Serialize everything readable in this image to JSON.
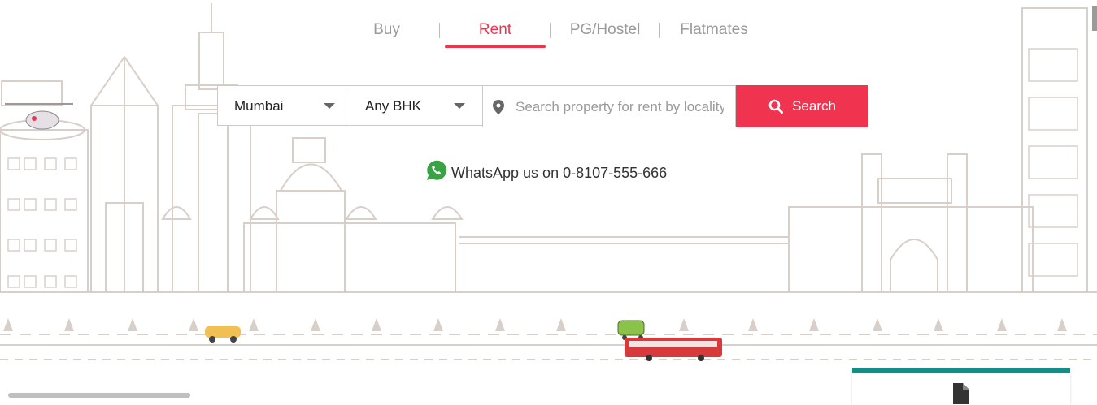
{
  "tabs": [
    {
      "label": "Buy",
      "active": false
    },
    {
      "label": "Rent",
      "active": true
    },
    {
      "label": "PG/Hostel",
      "active": false
    },
    {
      "label": "Flatmates",
      "active": false
    }
  ],
  "search": {
    "city": "Mumbai",
    "bhk": "Any BHK",
    "locality_placeholder": "Search property for rent by locality",
    "locality_value": "",
    "button_label": "Search"
  },
  "whatsapp": {
    "text": "WhatsApp us on 0-8107-555-666"
  },
  "colors": {
    "accent": "#f0344f",
    "tab_active": "#e8384f",
    "skyline": "#d9cfc9",
    "whatsapp": "#3aa144",
    "card_border": "#0f8f86"
  },
  "icons": [
    "map-pin-icon",
    "search-icon",
    "whatsapp-icon",
    "document-icon",
    "chevron-down-icon"
  ]
}
